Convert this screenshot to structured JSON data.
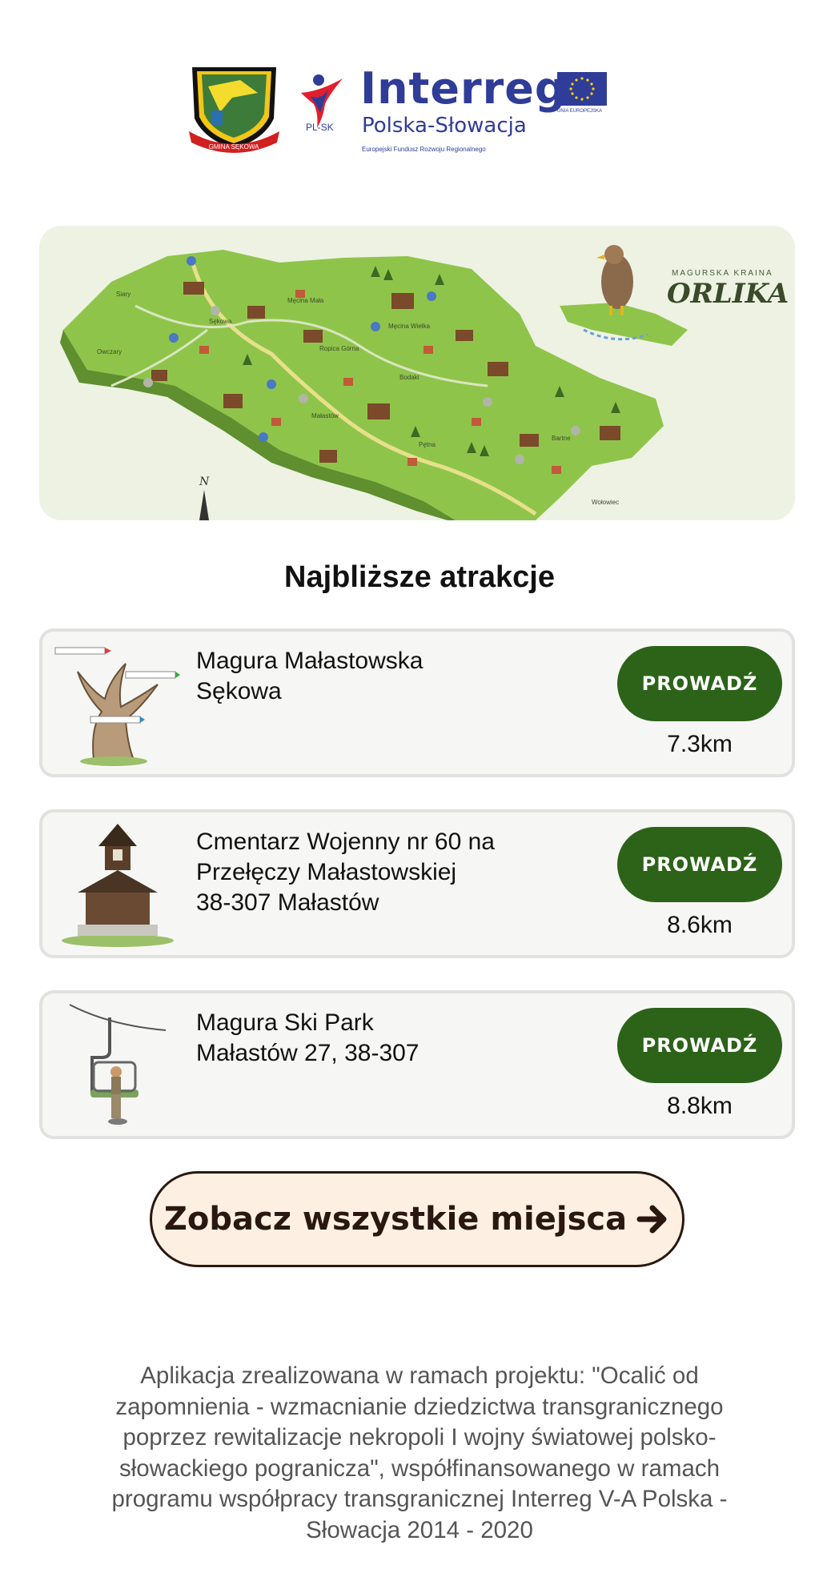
{
  "header": {
    "crest_text": "GMINA SĘKOWA",
    "plsk_label": "PL-SK",
    "interreg_title": "Interreg",
    "interreg_subtitle": "Polska-Słowacja",
    "interreg_fund": "Europejski Fundusz Rozwoju Regionalnego",
    "eu_label": "UNIA EUROPEJSKA"
  },
  "map": {
    "region_small": "MAGURSKA KRAINA",
    "region_big": "ORLIKA",
    "place_labels": [
      "Sękowa",
      "Męcina Mała",
      "Męcina Wielka",
      "Ropica Górna",
      "Owczary",
      "Siary",
      "Bodaki",
      "Bartne",
      "Małastów",
      "Wołowiec",
      "Pętna"
    ],
    "compass": "N"
  },
  "section_title": "Najbliższe atrakcje",
  "attractions": [
    {
      "lines": [
        "Magura Małastowska",
        "Sękowa"
      ],
      "button": "PROWADŹ",
      "distance": "7.3km",
      "icon": "signpost-tree-icon"
    },
    {
      "lines": [
        "Cmentarz Wojenny nr 60 na",
        "Przełęczy Małastowskiej",
        "38-307 Małastów"
      ],
      "button": "PROWADŹ",
      "distance": "8.6km",
      "icon": "wooden-chapel-icon"
    },
    {
      "lines": [
        "Magura Ski Park",
        "Małastów 27, 38-307"
      ],
      "button": "PROWADŹ",
      "distance": "8.8km",
      "icon": "chairlift-icon"
    }
  ],
  "see_all": {
    "label": "Zobacz wszystkie miejsca",
    "icon": "arrow-right-icon"
  },
  "footer_text": "Aplikacja zrealizowana w ramach projektu: \"Ocalić od zapomnienia - wzmacnianie dziedzictwa transgranicznego poprzez rewitalizacje nekropoli I wojny światowej polsko-słowackiego pogranicza\", współfinansowanego w ramach programu współpracy transgranicznej Interreg V-A Polska - Słowacja 2014 - 2020",
  "colors": {
    "primary_green": "#2c6318",
    "interreg_blue": "#2f3c98",
    "cta_background": "#fdf0e2",
    "cta_text": "#2a1810"
  }
}
